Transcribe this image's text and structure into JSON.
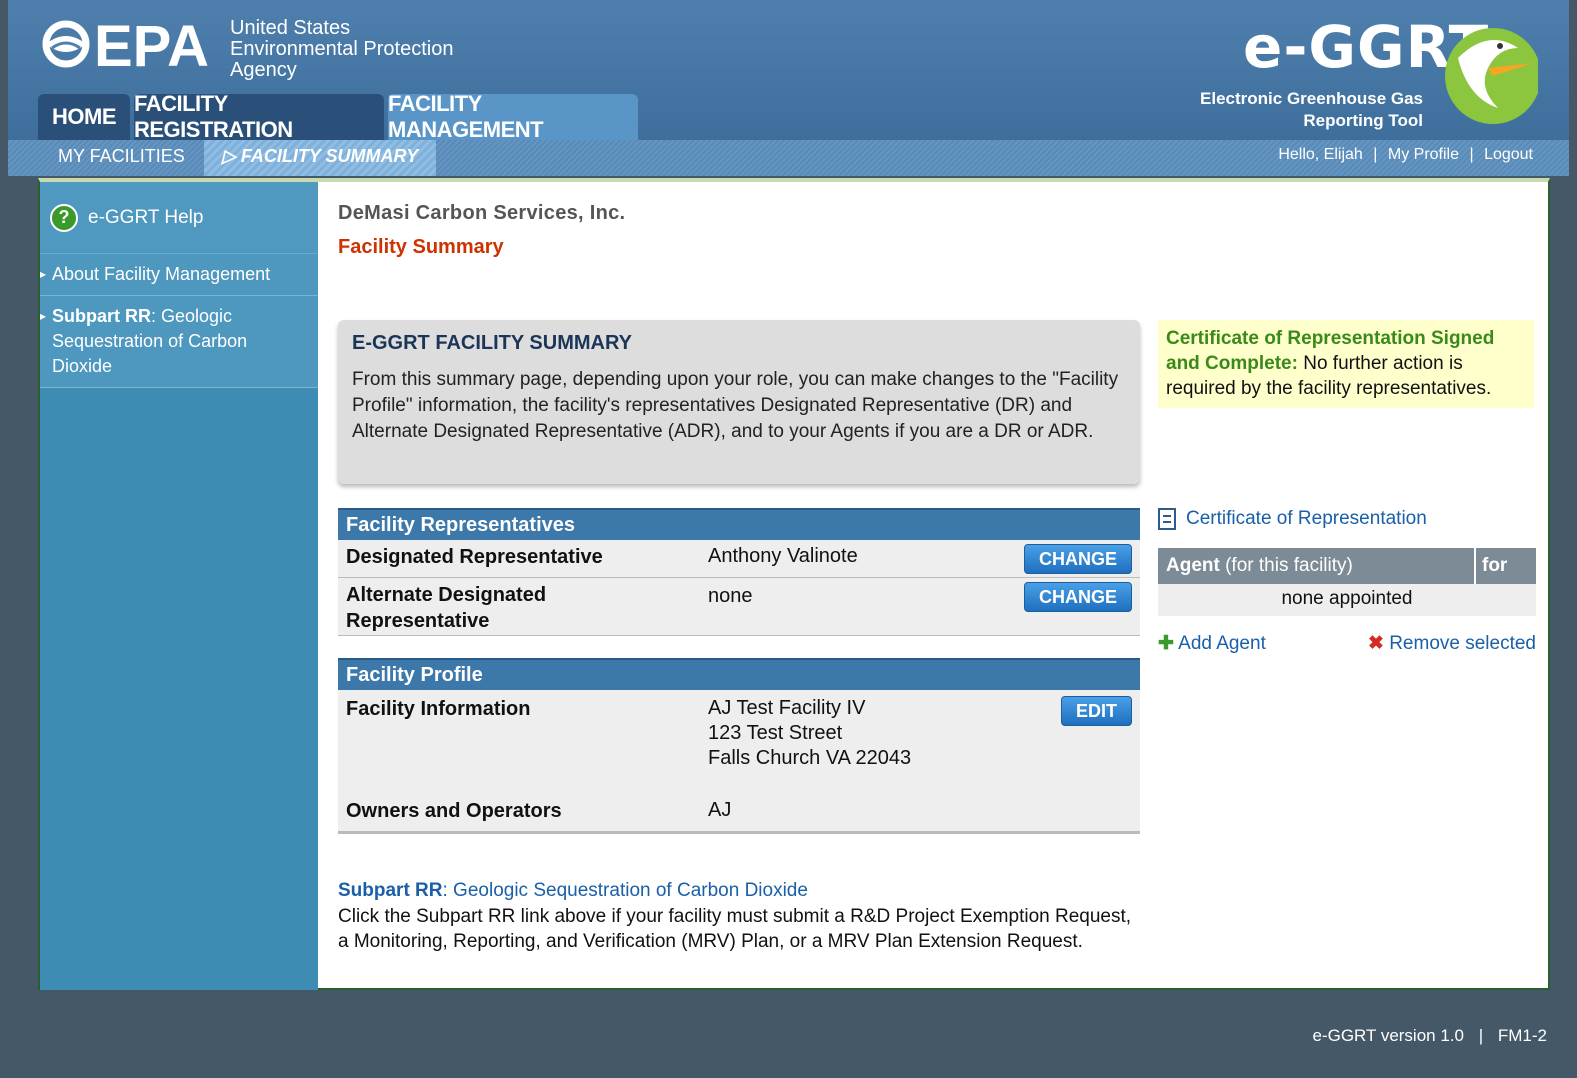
{
  "header": {
    "agency_line1": "United States",
    "agency_line2": "Environmental Protection",
    "agency_line3": "Agency",
    "epa_logo_text": "EPA",
    "app_logo": "e-GGRT",
    "app_sub1": "Electronic Greenhouse Gas",
    "app_sub2": "Reporting Tool"
  },
  "tabs": [
    {
      "label": "HOME"
    },
    {
      "label": "FACILITY REGISTRATION"
    },
    {
      "label": "FACILITY MANAGEMENT"
    }
  ],
  "subnav": {
    "my_facilities": "MY FACILITIES",
    "facility_summary": "FACILITY SUMMARY",
    "greeting": "Hello, Elijah",
    "my_profile": "My Profile",
    "logout": "Logout",
    "separator": "|"
  },
  "sidebar": {
    "help": "e-GGRT Help",
    "items": [
      {
        "label": "About Facility Management"
      },
      {
        "bold": "Subpart RR",
        "label": ": Geologic Sequestration of Carbon Dioxide"
      }
    ]
  },
  "main": {
    "org_name": "DeMasi Carbon Services, Inc.",
    "page_title": "Facility Summary",
    "info_title": "E-GGRT FACILITY SUMMARY",
    "info_text": "From this summary page, depending upon your role, you can make changes to the \"Facility Profile\" information, the facility's representatives Designated Representative (DR) and Alternate Designated Representative (ADR), and to your Agents if you are a DR or ADR.",
    "cert_status_bold": "Certificate of Representation Signed and Complete:",
    "cert_status_text": " No further action is required by the facility representatives.",
    "reps_header": "Facility Representatives",
    "reps": [
      {
        "label": "Designated Representative",
        "value": "Anthony Valinote",
        "button": "CHANGE"
      },
      {
        "label": "Alternate Designated Representative",
        "value": "none",
        "button": "CHANGE"
      }
    ],
    "profile_header": "Facility Profile",
    "facility_info_label": "Facility Information",
    "facility_name": "AJ Test Facility IV",
    "facility_street": "123 Test Street",
    "facility_city": "Falls Church VA 22043",
    "edit_button": "EDIT",
    "owners_label": "Owners and Operators",
    "owners_value": "AJ",
    "subpart_bold": "Subpart RR",
    "subpart_link": ": Geologic Sequestration of Carbon Dioxide",
    "subpart_desc": "Click the Subpart RR link above if your facility must submit a R&D Project Exemption Request, a Monitoring, Reporting, and Verification (MRV) Plan, or a MRV Plan Extension Request."
  },
  "right": {
    "cert_link": "Certificate of Representation",
    "agent_col_bold": "Agent",
    "agent_col_rest": " (for this facility)",
    "for_col": "for",
    "none_appointed": "none appointed",
    "add_agent": "Add Agent",
    "remove_selected": "Remove selected"
  },
  "footer": {
    "version": "e-GGRT version 1.0",
    "separator": "|",
    "screen_id": "FM1-2"
  }
}
